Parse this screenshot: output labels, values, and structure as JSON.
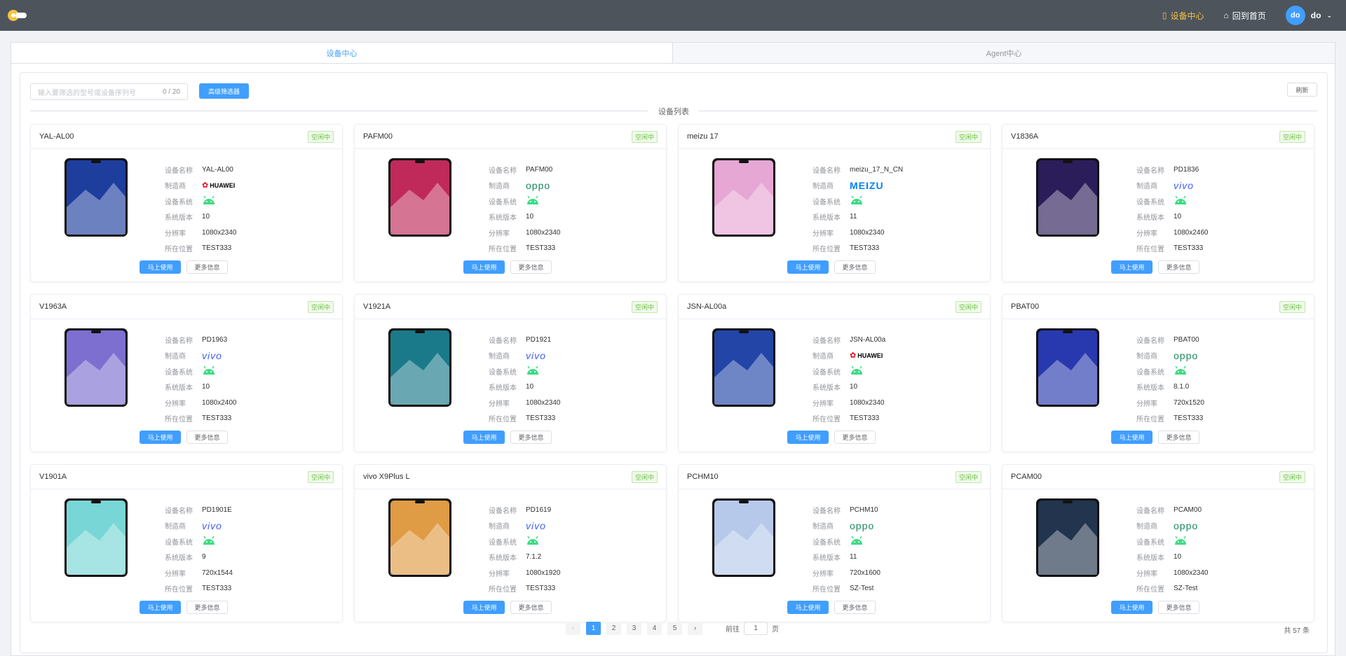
{
  "header": {
    "nav": [
      {
        "label": "设备中心",
        "icon": "tablet-icon",
        "active": true
      },
      {
        "label": "回到首页",
        "icon": "home-icon",
        "active": false
      }
    ],
    "user": {
      "avatar_text": "do",
      "name": "do"
    }
  },
  "tabs": [
    "设备中心",
    "Agent中心"
  ],
  "search": {
    "placeholder": "输入要筛选的型号或设备序列号",
    "counter": "0 / 20"
  },
  "filter_button": "高级筛选器",
  "refresh_button": "刷新",
  "section_title": "设备列表",
  "labels": {
    "name": "设备名称",
    "maker": "制造商",
    "os": "设备系统",
    "version": "系统版本",
    "resolution": "分辨率",
    "location": "所在位置",
    "use": "马上使用",
    "more": "更多信息"
  },
  "colors": {
    "primary": "#409eff",
    "topbar": "#4d545c",
    "idle": "#67c23a"
  },
  "devices": [
    {
      "title": "YAL-AL00",
      "status": "空闲中",
      "name": "YAL-AL00",
      "maker": "HUAWEI",
      "os_icon": "android-icon",
      "version": "10",
      "resolution": "1080x2340",
      "location": "TEST333",
      "phone_color": "#1e3e9e"
    },
    {
      "title": "PAFM00",
      "status": "空闲中",
      "name": "PAFM00",
      "maker": "oppo",
      "os_icon": "android-icon",
      "version": "10",
      "resolution": "1080x2340",
      "location": "TEST333",
      "phone_color": "#c02a5b"
    },
    {
      "title": "meizu 17",
      "status": "空闲中",
      "name": "meizu_17_N_CN",
      "maker": "MEIZU",
      "os_icon": "android-icon",
      "version": "11",
      "resolution": "1080x2340",
      "location": "TEST333",
      "phone_color": "#e6a7d5"
    },
    {
      "title": "V1836A",
      "status": "空闲中",
      "name": "PD1836",
      "maker": "vivo",
      "os_icon": "android-icon",
      "version": "10",
      "resolution": "1080x2460",
      "location": "TEST333",
      "phone_color": "#2b1d5a"
    },
    {
      "title": "V1963A",
      "status": "空闲中",
      "name": "PD1963",
      "maker": "vivo",
      "os_icon": "android-icon",
      "version": "10",
      "resolution": "1080x2400",
      "location": "TEST333",
      "phone_color": "#7d6fd0"
    },
    {
      "title": "V1921A",
      "status": "空闲中",
      "name": "PD1921",
      "maker": "vivo",
      "os_icon": "android-icon",
      "version": "10",
      "resolution": "1080x2340",
      "location": "TEST333",
      "phone_color": "#1a7a8a"
    },
    {
      "title": "JSN-AL00a",
      "status": "空闲中",
      "name": "JSN-AL00a",
      "maker": "HUAWEI",
      "os_icon": "android-icon",
      "version": "10",
      "resolution": "1080x2340",
      "location": "TEST333",
      "phone_color": "#2345a8"
    },
    {
      "title": "PBAT00",
      "status": "空闲中",
      "name": "PBAT00",
      "maker": "oppo",
      "os_icon": "android-icon",
      "version": "8.1.0",
      "resolution": "720x1520",
      "location": "TEST333",
      "phone_color": "#2839b0"
    },
    {
      "title": "V1901A",
      "status": "空闲中",
      "name": "PD1901E",
      "maker": "vivo",
      "os_icon": "android-icon",
      "version": "9",
      "resolution": "720x1544",
      "location": "TEST333",
      "phone_color": "#79d6d6"
    },
    {
      "title": "vivo X9Plus L",
      "status": "空闲中",
      "name": "PD1619",
      "maker": "vivo",
      "os_icon": "android-icon",
      "version": "7.1.2",
      "resolution": "1080x1920",
      "location": "TEST333",
      "phone_color": "#e09b45"
    },
    {
      "title": "PCHM10",
      "status": "空闲中",
      "name": "PCHM10",
      "maker": "oppo",
      "os_icon": "android-icon",
      "version": "11",
      "resolution": "720x1600",
      "location": "SZ-Test",
      "phone_color": "#b7c9ea"
    },
    {
      "title": "PCAM00",
      "status": "空闲中",
      "name": "PCAM00",
      "maker": "oppo",
      "os_icon": "android-icon",
      "version": "10",
      "resolution": "1080x2340",
      "location": "SZ-Test",
      "phone_color": "#22344e"
    }
  ],
  "pagination": {
    "pages": [
      "1",
      "2",
      "3",
      "4",
      "5"
    ],
    "current": "1",
    "goto_label": "前往",
    "goto_value": "1",
    "goto_suffix": "页",
    "total": "共 57 条"
  }
}
